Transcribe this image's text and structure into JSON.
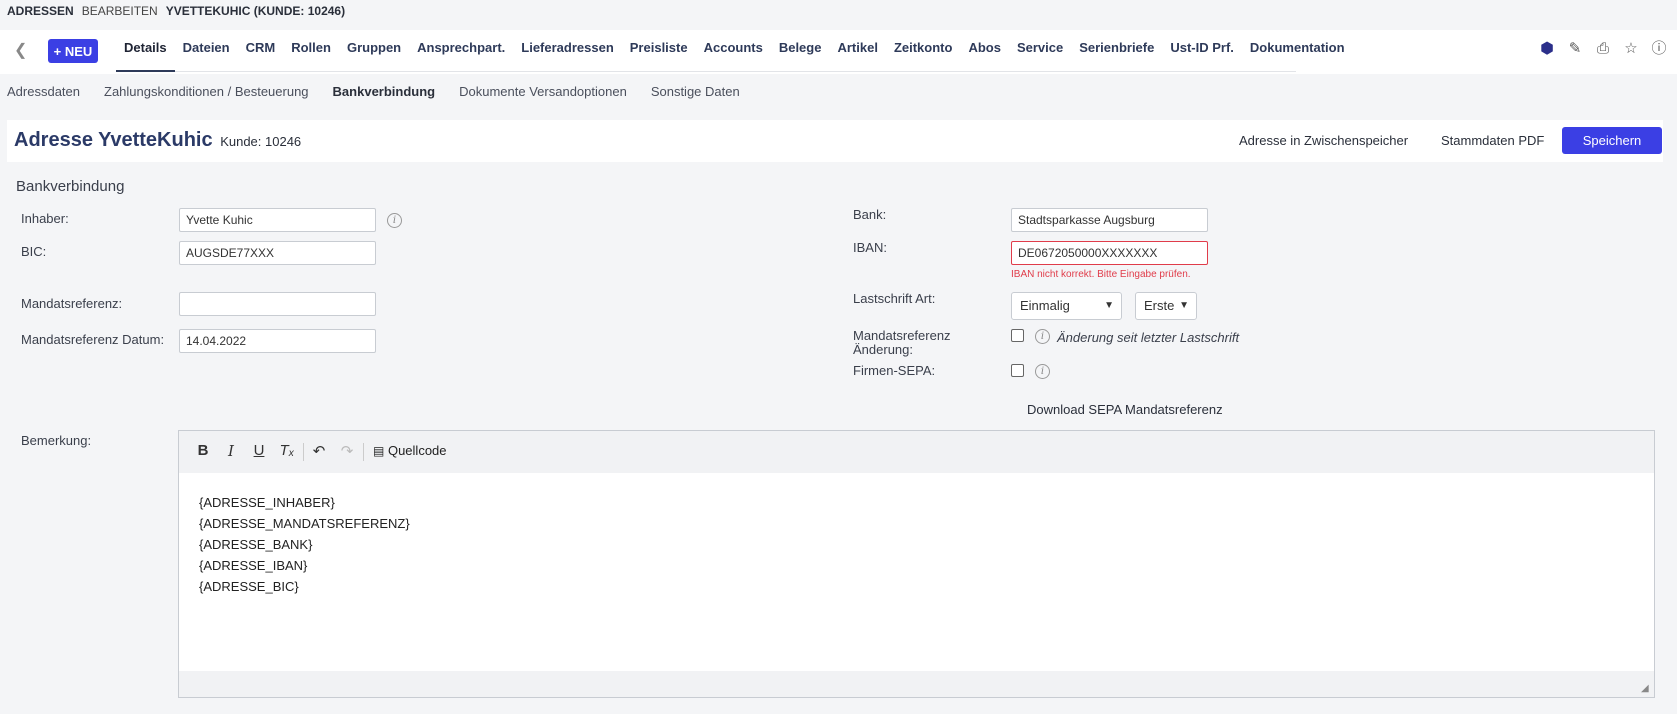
{
  "breadcrumb": {
    "module": "ADRESSEN",
    "action": "BEARBEITEN",
    "record": "YVETTEKUHIC (KUNDE: 10246)"
  },
  "nav": {
    "new_label": "+ NEU",
    "tabs": [
      "Details",
      "Dateien",
      "CRM",
      "Rollen",
      "Gruppen",
      "Ansprechpart.",
      "Lieferadressen",
      "Preisliste",
      "Accounts",
      "Belege",
      "Artikel",
      "Zeitkonto",
      "Abos",
      "Service",
      "Serienbriefe",
      "Ust-ID Prf.",
      "Dokumentation"
    ],
    "active_tab": "Details",
    "icons": [
      "brand-logo-icon",
      "pencil-icon",
      "print-icon",
      "star-icon",
      "help-icon"
    ]
  },
  "subtabs": [
    "Adressdaten",
    "Zahlungskonditionen / Besteuerung",
    "Bankverbindung",
    "Dokumente Versandoptionen",
    "Sonstige Daten"
  ],
  "active_subtab": "Bankverbindung",
  "header": {
    "title_prefix": "Adresse YvetteKuhic",
    "kunde": "Kunde: 10246",
    "clipboard_label": "Adresse in Zwischenspeicher",
    "pdf_label": "Stammdaten PDF",
    "save_label": "Speichern"
  },
  "section": {
    "title": "Bankverbindung"
  },
  "form": {
    "inhaber_label": "Inhaber:",
    "inhaber_value": "Yvette Kuhic",
    "bic_label": "BIC:",
    "bic_value": "AUGSDE77XXX",
    "mandat_label": "Mandatsreferenz:",
    "mandat_value": "",
    "mandat_datum_label": "Mandatsreferenz Datum:",
    "mandat_datum_value": "14.04.2022",
    "bank_label": "Bank:",
    "bank_value": "Stadtsparkasse Augsburg",
    "iban_label": "IBAN:",
    "iban_value": "DE0672050000XXXXXXX",
    "iban_error": "IBAN nicht korrekt. Bitte Eingabe prüfen.",
    "lastschrift_label": "Lastschrift Art:",
    "lastschrift_value": "Einmalig",
    "lastschrift2_value": "Erste",
    "mandat_aenderung_label_1": "Mandatsreferenz",
    "mandat_aenderung_label_2": "Änderung:",
    "mandat_aenderung_note": "Änderung seit letzter Lastschrift",
    "firmen_sepa_label": "Firmen-SEPA:",
    "sepa_download": "Download SEPA Mandatsreferenz"
  },
  "remark": {
    "label": "Bemerkung:",
    "source_label": "Quellcode",
    "lines": [
      "{ADRESSE_INHABER}",
      "{ADRESSE_MANDATSREFERENZ}",
      "{ADRESSE_BANK}",
      "{ADRESSE_IBAN}",
      "{ADRESSE_BIC}"
    ]
  },
  "colors": {
    "accent": "#3b3fe4",
    "error": "#e03c4a",
    "title": "#2b3a67"
  }
}
